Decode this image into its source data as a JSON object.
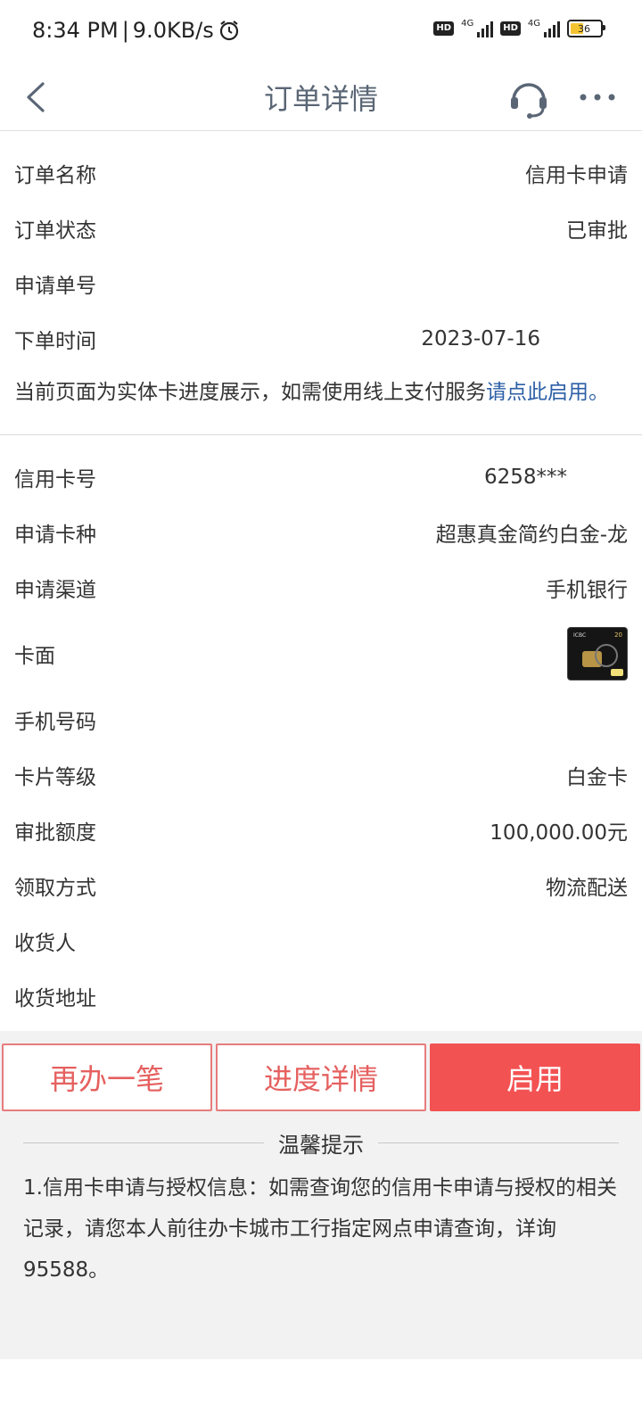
{
  "status_bar": {
    "time": "8:34 PM",
    "separator": "|",
    "speed": "9.0KB/s",
    "hd1": "HD",
    "net1": "4G",
    "hd2": "HD",
    "net2": "4G",
    "battery": "36"
  },
  "nav": {
    "title": "订单详情"
  },
  "order": {
    "rows": [
      {
        "label": "订单名称",
        "value": "信用卡申请"
      },
      {
        "label": "订单状态",
        "value": "已审批"
      },
      {
        "label": "申请单号",
        "value": ""
      },
      {
        "label": "下单时间",
        "value": "2023-07-16"
      }
    ],
    "notice_text": "当前页面为实体卡进度展示，如需使用线上支付服务",
    "notice_link": "请点此启用",
    "notice_end": "。"
  },
  "card": {
    "rows": [
      {
        "label": "信用卡号",
        "value": "6258***"
      },
      {
        "label": "申请卡种",
        "value": "超惠真金简约白金-龙"
      },
      {
        "label": "申请渠道",
        "value": "手机银行"
      },
      {
        "label": "卡面",
        "value": ""
      },
      {
        "label": "手机号码",
        "value": ""
      },
      {
        "label": "卡片等级",
        "value": "白金卡"
      },
      {
        "label": "审批额度",
        "value": "100,000.00元"
      },
      {
        "label": "领取方式",
        "value": "物流配送"
      },
      {
        "label": "收货人",
        "value": ""
      },
      {
        "label": "收货地址",
        "value": ""
      }
    ],
    "card_face_text": "ICBC",
    "card_face_badge": "20"
  },
  "actions": {
    "again": "再办一笔",
    "progress": "进度详情",
    "enable": "启用"
  },
  "tips": {
    "title": "温馨提示",
    "body": "1.信用卡申请与授权信息：如需查询您的信用卡申请与授权的相关记录，请您本人前往办卡城市工行指定网点申请查询，详询95588。"
  }
}
